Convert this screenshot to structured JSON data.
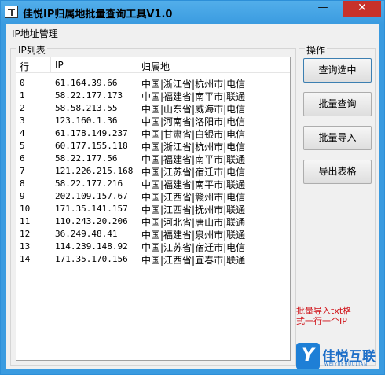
{
  "window": {
    "title": "佳悦IP归属地批量查询工具V1.0",
    "minimize": "—",
    "maximize": "",
    "close": "✕"
  },
  "menu": {
    "ip_manage": "IP地址管理"
  },
  "ip_group": {
    "legend": "IP列表",
    "columns": {
      "row": "行",
      "ip": "IP",
      "location": "归属地"
    },
    "rows": [
      {
        "row": "0",
        "ip": "61.164.39.66",
        "location": "中国|浙江省|杭州市|电信"
      },
      {
        "row": "1",
        "ip": "58.22.177.173",
        "location": "中国|福建省|南平市|联通"
      },
      {
        "row": "2",
        "ip": "58.58.213.55",
        "location": "中国|山东省|威海市|电信"
      },
      {
        "row": "3",
        "ip": "123.160.1.36",
        "location": "中国|河南省|洛阳市|电信"
      },
      {
        "row": "4",
        "ip": "61.178.149.237",
        "location": "中国|甘肃省|白银市|电信"
      },
      {
        "row": "5",
        "ip": "60.177.155.118",
        "location": "中国|浙江省|杭州市|电信"
      },
      {
        "row": "6",
        "ip": "58.22.177.56",
        "location": "中国|福建省|南平市|联通"
      },
      {
        "row": "7",
        "ip": "121.226.215.168",
        "location": "中国|江苏省|宿迁市|电信"
      },
      {
        "row": "8",
        "ip": "58.22.177.216",
        "location": "中国|福建省|南平市|联通"
      },
      {
        "row": "9",
        "ip": "202.109.157.67",
        "location": "中国|江西省|赣州市|电信"
      },
      {
        "row": "10",
        "ip": "171.35.141.157",
        "location": "中国|江西省|抚州市|联通"
      },
      {
        "row": "11",
        "ip": "110.243.20.206",
        "location": "中国|河北省|唐山市|联通"
      },
      {
        "row": "12",
        "ip": "36.249.48.41",
        "location": "中国|福建省|泉州市|联通"
      },
      {
        "row": "13",
        "ip": "114.239.148.92",
        "location": "中国|江苏省|宿迁市|电信"
      },
      {
        "row": "14",
        "ip": "171.35.170.156",
        "location": "中国|江西省|宜春市|联通"
      }
    ]
  },
  "ops_group": {
    "legend": "操作",
    "buttons": {
      "query_selected": "查询选中",
      "batch_query": "批量查询",
      "batch_import": "批量导入",
      "export_table": "导出表格"
    }
  },
  "note": {
    "line1": "批量导入txt格",
    "line2": "式一行一个IP"
  },
  "watermark": {
    "logo_glyph": "Y",
    "name": "佳悦互联",
    "sub": "WEIYUEHUULIAN"
  },
  "colors": {
    "title_bar": "#3a9be0",
    "close_button": "#c7322a",
    "note_red": "#d0141a",
    "watermark_blue": "#1e7fd6"
  }
}
